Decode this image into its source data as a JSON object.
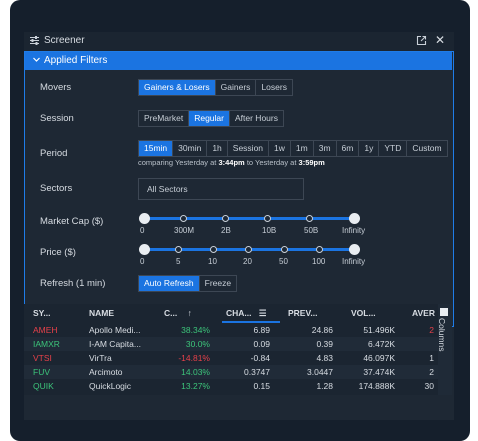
{
  "window": {
    "title": "Screener"
  },
  "panel": {
    "title": "Applied Filters"
  },
  "movers": {
    "label": "Movers",
    "options": [
      "Gainers & Losers",
      "Gainers",
      "Losers"
    ],
    "selected": 0
  },
  "session": {
    "label": "Session",
    "options": [
      "PreMarket",
      "Regular",
      "After Hours"
    ],
    "selected": 1
  },
  "period": {
    "label": "Period",
    "options": [
      "15min",
      "30min",
      "1h",
      "Session",
      "1w",
      "1m",
      "3m",
      "6m",
      "1y",
      "YTD",
      "Custom"
    ],
    "selected": 0,
    "comparing_prefix": "comparing Yesterday at ",
    "time_from": "3:44pm",
    "comparing_mid": " to Yesterday at ",
    "time_to": "3:59pm"
  },
  "sectors": {
    "label": "Sectors",
    "value": "All Sectors"
  },
  "market_cap": {
    "label": "Market Cap ($)",
    "ticks": [
      "0",
      "300M",
      "2B",
      "10B",
      "50B",
      "Infinity"
    ]
  },
  "price": {
    "label": "Price ($)",
    "ticks": [
      "0",
      "5",
      "10",
      "20",
      "50",
      "100",
      "Infinity"
    ]
  },
  "refresh": {
    "label": "Refresh (1 min)",
    "options": [
      "Auto Refresh",
      "Freeze"
    ],
    "selected": 0
  },
  "table": {
    "columns": [
      "SY...",
      "NAME",
      "C...",
      "CHA...",
      "PREV...",
      "VOL...",
      "AVER"
    ],
    "sort_arrow": "↑",
    "rows": [
      {
        "symbol": "AMEH",
        "name": "Apollo Medi...",
        "change_pct": "38.34%",
        "change": "6.89",
        "prev": "24.86",
        "volume": "51.496K",
        "avg": "2",
        "up": true
      },
      {
        "symbol": "IAMXR",
        "name": "I-AM Capita...",
        "change_pct": "30.0%",
        "change": "0.09",
        "prev": "0.39",
        "volume": "6.472K",
        "avg": "",
        "up": true
      },
      {
        "symbol": "VTSI",
        "name": "VirTra",
        "change_pct": "-14.81%",
        "change": "-0.84",
        "prev": "4.83",
        "volume": "46.097K",
        "avg": "1",
        "up": false
      },
      {
        "symbol": "FUV",
        "name": "Arcimoto",
        "change_pct": "14.03%",
        "change": "0.3747",
        "prev": "3.0447",
        "volume": "37.474K",
        "avg": "2",
        "up": true
      },
      {
        "symbol": "QUIK",
        "name": "QuickLogic",
        "change_pct": "13.27%",
        "change": "0.15",
        "prev": "1.28",
        "volume": "174.888K",
        "avg": "30",
        "up": true
      }
    ]
  },
  "columns_panel": {
    "label": "Columns"
  },
  "colors": {
    "accent": "#1b74e1",
    "up": "#3cc47a",
    "down": "#e5414a"
  },
  "icons": {
    "screener": "filter-sliders-icon",
    "popout": "popout-icon",
    "close": "close-icon",
    "collapse": "chevron-down-icon",
    "columns_menu": "hamburger-icon"
  }
}
